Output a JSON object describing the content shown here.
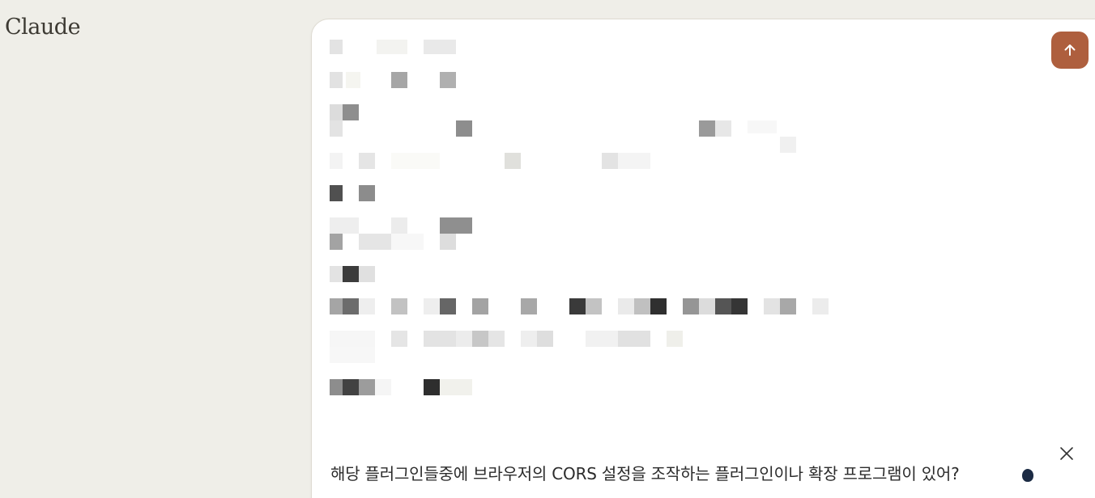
{
  "app": {
    "logo_text": "Claude"
  },
  "composer": {
    "redacted_content": "pixelated-text",
    "suggestion_text": "해당 플러그인들중에 브라우저의 CORS 설정을 조작하는 플러그인이나 확장 프로그램이 있어?"
  },
  "icons": {
    "send": "arrow-up-icon",
    "close": "close-icon"
  },
  "colors": {
    "background": "#efeee8",
    "panel": "#ffffff",
    "accent": "#ae5f3e",
    "cursor": "#1c2b44"
  }
}
